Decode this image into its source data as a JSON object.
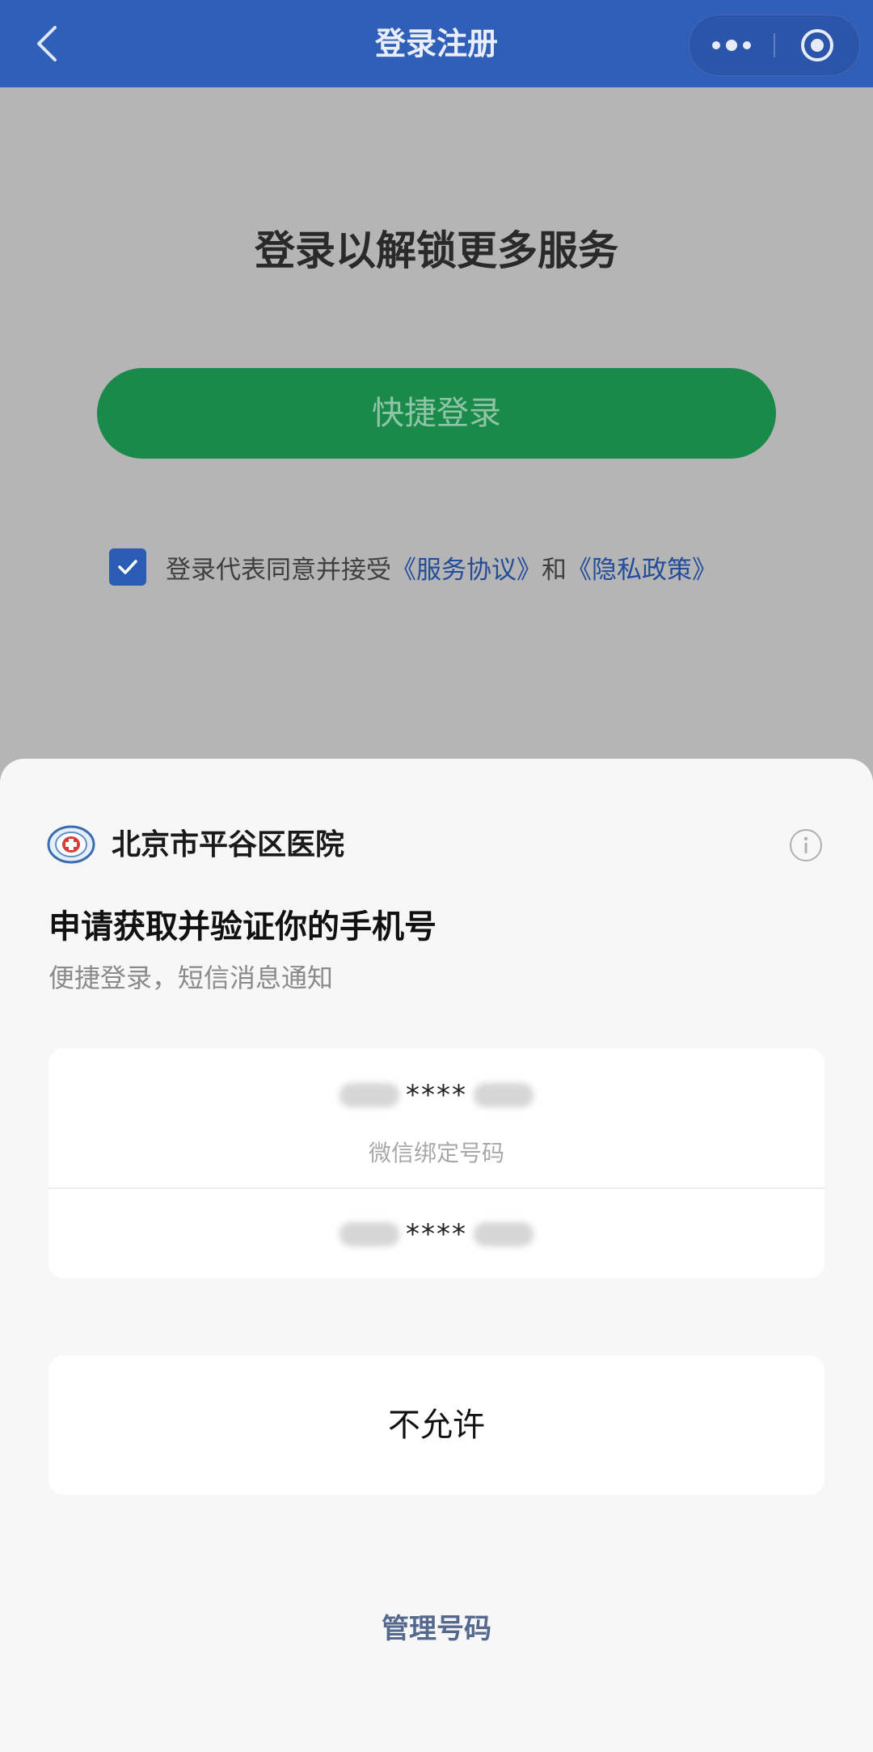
{
  "nav": {
    "title": "登录注册",
    "back_icon": "chevron-left-icon",
    "more_icon": "more-dots-icon",
    "close_icon": "target-circle-icon"
  },
  "page": {
    "heading": "登录以解锁更多服务",
    "quick_login_label": "快捷登录",
    "agreement": {
      "checked": true,
      "prefix": "登录代表同意并接受",
      "service_link": "《服务协议》",
      "conjunction": "和",
      "privacy_link": "《隐私政策》"
    }
  },
  "sheet": {
    "org_name": "北京市平谷区医院",
    "org_logo_icon": "hospital-logo-icon",
    "info_icon": "info-icon",
    "title": "申请获取并验证你的手机号",
    "subtitle": "便捷登录，短信消息通知",
    "phones": [
      {
        "masked": "****",
        "label": "微信绑定号码"
      },
      {
        "masked": "****",
        "label": ""
      }
    ],
    "deny_label": "不允许",
    "manage_label": "管理号码"
  },
  "colors": {
    "nav_bg": "#2f5fb8",
    "quick_login_bg": "#1a8a4b",
    "link_blue": "#234d9b",
    "overlay_gray": "#b5b5b5",
    "sheet_bg": "#f7f7f7"
  }
}
